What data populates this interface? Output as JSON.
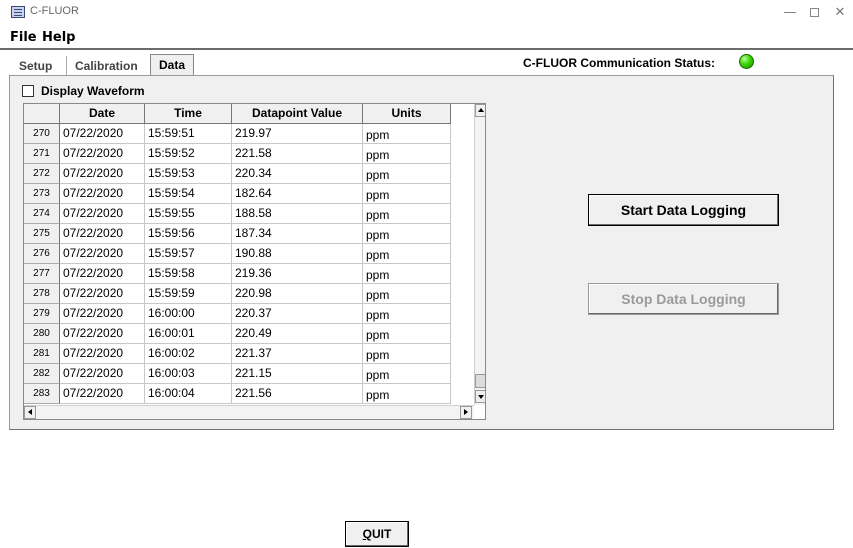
{
  "window": {
    "title": "C-FLUOR",
    "min_glyph": "—",
    "close_glyph": "✕"
  },
  "menu": {
    "file": "File",
    "help": "Help"
  },
  "tabs": {
    "setup": "Setup",
    "calibration": "Calibration",
    "data": "Data",
    "active": "Data"
  },
  "status": {
    "label": "C-FLUOR Communication Status:",
    "led_color": "#38d400"
  },
  "display_waveform": {
    "label": "Display Waveform",
    "checked": false
  },
  "table": {
    "columns": [
      "",
      "Date",
      "Time",
      "Datapoint Value",
      "Units"
    ],
    "rows": [
      {
        "num": "270",
        "date": "07/22/2020",
        "time": "15:59:51",
        "value": "219.97",
        "units": "ppm"
      },
      {
        "num": "271",
        "date": "07/22/2020",
        "time": "15:59:52",
        "value": "221.58",
        "units": "ppm"
      },
      {
        "num": "272",
        "date": "07/22/2020",
        "time": "15:59:53",
        "value": "220.34",
        "units": "ppm"
      },
      {
        "num": "273",
        "date": "07/22/2020",
        "time": "15:59:54",
        "value": "182.64",
        "units": "ppm"
      },
      {
        "num": "274",
        "date": "07/22/2020",
        "time": "15:59:55",
        "value": "188.58",
        "units": "ppm"
      },
      {
        "num": "275",
        "date": "07/22/2020",
        "time": "15:59:56",
        "value": "187.34",
        "units": "ppm"
      },
      {
        "num": "276",
        "date": "07/22/2020",
        "time": "15:59:57",
        "value": "190.88",
        "units": "ppm"
      },
      {
        "num": "277",
        "date": "07/22/2020",
        "time": "15:59:58",
        "value": "219.36",
        "units": "ppm"
      },
      {
        "num": "278",
        "date": "07/22/2020",
        "time": "15:59:59",
        "value": "220.98",
        "units": "ppm"
      },
      {
        "num": "279",
        "date": "07/22/2020",
        "time": "16:00:00",
        "value": "220.37",
        "units": "ppm"
      },
      {
        "num": "280",
        "date": "07/22/2020",
        "time": "16:00:01",
        "value": "220.49",
        "units": "ppm"
      },
      {
        "num": "281",
        "date": "07/22/2020",
        "time": "16:00:02",
        "value": "221.37",
        "units": "ppm"
      },
      {
        "num": "282",
        "date": "07/22/2020",
        "time": "16:00:03",
        "value": "221.15",
        "units": "ppm"
      },
      {
        "num": "283",
        "date": "07/22/2020",
        "time": "16:00:04",
        "value": "221.56",
        "units": "ppm"
      }
    ]
  },
  "buttons": {
    "start": "Start Data Logging",
    "stop": "Stop Data Logging",
    "stop_enabled": false,
    "quit_pre": "",
    "quit_underlined": "Q",
    "quit_post": "UIT"
  },
  "icons": {
    "app": "app-icon",
    "minimize": "minimize-icon",
    "maximize": "maximize-icon",
    "close": "close-icon",
    "status": "status-led-icon"
  }
}
